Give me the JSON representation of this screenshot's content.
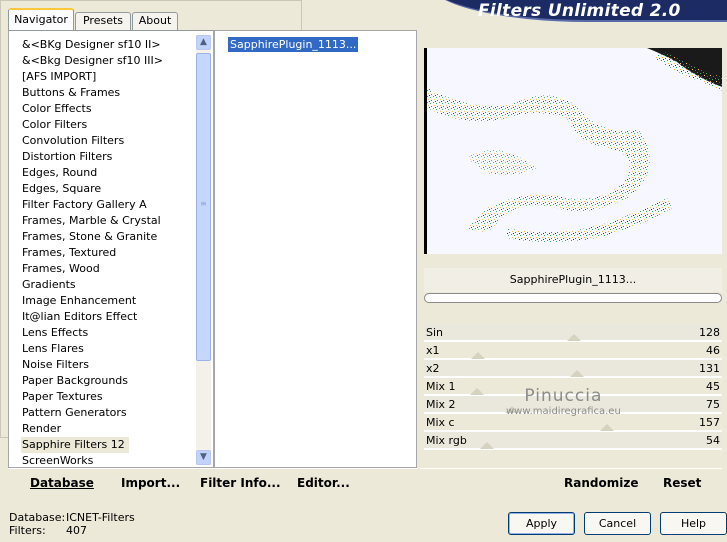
{
  "app": {
    "title": "Filters Unlimited 2.0"
  },
  "tabs": [
    {
      "label": "Navigator",
      "active": true
    },
    {
      "label": "Presets",
      "active": false
    },
    {
      "label": "About",
      "active": false
    }
  ],
  "categories": [
    "&<BKg Designer sf10 II>",
    "&<Bkg Designer sf10 III>",
    "[AFS IMPORT]",
    "Buttons & Frames",
    "Color Effects",
    "Color Filters",
    "Convolution Filters",
    "Distortion Filters",
    "Edges, Round",
    "Edges, Square",
    "Filter Factory Gallery A",
    "Frames, Marble & Crystal",
    "Frames, Stone & Granite",
    "Frames, Textured",
    "Frames, Wood",
    "Gradients",
    "Image Enhancement",
    "It@lian Editors Effect",
    "Lens Effects",
    "Lens Flares",
    "Noise Filters",
    "Paper Backgrounds",
    "Paper Textures",
    "Pattern Generators",
    "Render",
    "Sapphire Filters 12",
    "ScreenWorks"
  ],
  "selected_category": "Sapphire Filters 12",
  "filters": [
    "SapphirePlugin_1113..."
  ],
  "preview": {
    "filter_name": "SapphirePlugin_1113...",
    "progress": 0
  },
  "sliders": [
    {
      "label": "Sin",
      "value": "128",
      "max": 255
    },
    {
      "label": "x1",
      "value": "46",
      "max": 255
    },
    {
      "label": "x2",
      "value": "131",
      "max": 255
    },
    {
      "label": "Mix 1",
      "value": "45",
      "max": 255
    },
    {
      "label": "Mix 2",
      "value": "75",
      "max": 255
    },
    {
      "label": "Mix c",
      "value": "157",
      "max": 255
    },
    {
      "label": "Mix rgb",
      "value": "54",
      "max": 255
    }
  ],
  "watermark": {
    "line1": "Pinuccia",
    "line2": "www.maidiregrafica.eu"
  },
  "bottom_left": {
    "database": "Database",
    "import": "Import...",
    "filter_info": "Filter Info...",
    "editor": "Editor..."
  },
  "bottom_right": {
    "randomize": "Randomize",
    "reset": "Reset"
  },
  "status": {
    "database_key": "Database:",
    "database_val": "ICNET-Filters",
    "filters_key": "Filters:",
    "filters_val": "407"
  },
  "buttons": {
    "apply": "Apply",
    "cancel": "Cancel",
    "help": "Help"
  },
  "colors": {
    "banner": "#1c2b63",
    "selection": "#316ac5",
    "dialog_bg": "#ece9d8"
  }
}
